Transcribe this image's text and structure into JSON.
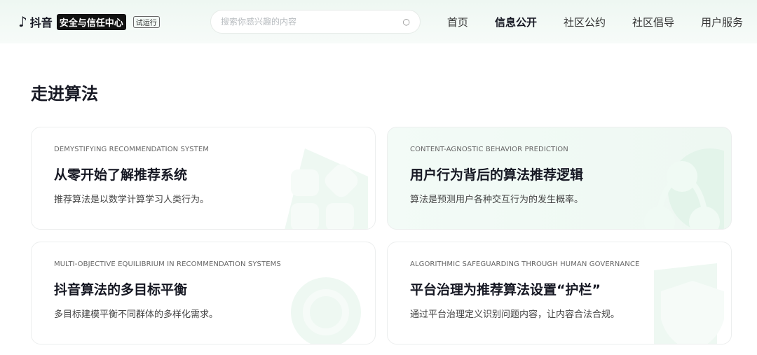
{
  "header": {
    "logo_brand": "抖音",
    "logo_center": "安全与信任中心",
    "logo_beta": "试运行",
    "search_placeholder": "搜索你感兴趣的内容",
    "nav": [
      "首页",
      "信息公开",
      "社区公约",
      "社区倡导",
      "用户服务"
    ]
  },
  "page_title": "走进算法",
  "cards": [
    {
      "kicker": "DEMYSTIFYING RECOMMENDATION SYSTEM",
      "title": "从零开始了解推荐系统",
      "desc": "推荐算法是以数学计算学习人类行为。"
    },
    {
      "kicker": "CONTENT-AGNOSTIC BEHAVIOR PREDICTION",
      "title": "用户行为背后的算法推荐逻辑",
      "desc": "算法是预测用户各种交互行为的发生概率。"
    },
    {
      "kicker": "MULTI-OBJECTIVE EQUILIBRIUM IN RECOMMENDATION SYSTEMS",
      "title": "抖音算法的多目标平衡",
      "desc": "多目标建模平衡不同群体的多样化需求。"
    },
    {
      "kicker": "ALGORITHMIC SAFEGUARDING THROUGH HUMAN GOVERNANCE",
      "title": "平台治理为推荐算法设置“护栏”",
      "desc": "通过平台治理定义识别问题内容，让内容合法合规。"
    }
  ]
}
